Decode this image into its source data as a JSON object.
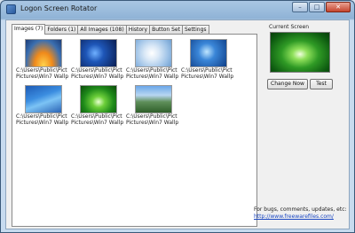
{
  "window": {
    "title": "Logon Screen Rotator"
  },
  "title_buttons": {
    "minimize": "–",
    "maximize": "□",
    "close": "✕"
  },
  "tabs": [
    {
      "label": "Images (7)",
      "active": true
    },
    {
      "label": "Folders (1)",
      "active": false
    },
    {
      "label": "All Images (108)",
      "active": false
    },
    {
      "label": "History",
      "active": false
    },
    {
      "label": "Button Set",
      "active": false
    },
    {
      "label": "Settings",
      "active": false
    }
  ],
  "images": [
    {
      "line1": "C:\\Users\\Public\\Pict",
      "line2": "Pictures\\Win7 Wallp"
    },
    {
      "line1": "C:\\Users\\Public\\Pict",
      "line2": "Pictures\\Win7 Wallp"
    },
    {
      "line1": "C:\\Users\\Public\\Pict",
      "line2": "Pictures\\Win7 Wallp"
    },
    {
      "line1": "C:\\Users\\Public\\Pict",
      "line2": "Pictures\\Win7 Wallp"
    },
    {
      "line1": "C:\\Users\\Public\\Pict",
      "line2": "Pictures\\Win7 Wallp"
    },
    {
      "line1": "C:\\Users\\Public\\Pict",
      "line2": "Pictures\\Win7 Wallp"
    },
    {
      "line1": "C:\\Users\\Public\\Pict",
      "line2": "Pictures\\Win7 Wallp"
    }
  ],
  "current_screen": {
    "label": "Current Screen"
  },
  "buttons": {
    "change_now": "Change Now",
    "test": "Test"
  },
  "footer": {
    "text": "For bugs, comments, updates, etc:",
    "link": "http://www.freewarefiles.com/"
  }
}
